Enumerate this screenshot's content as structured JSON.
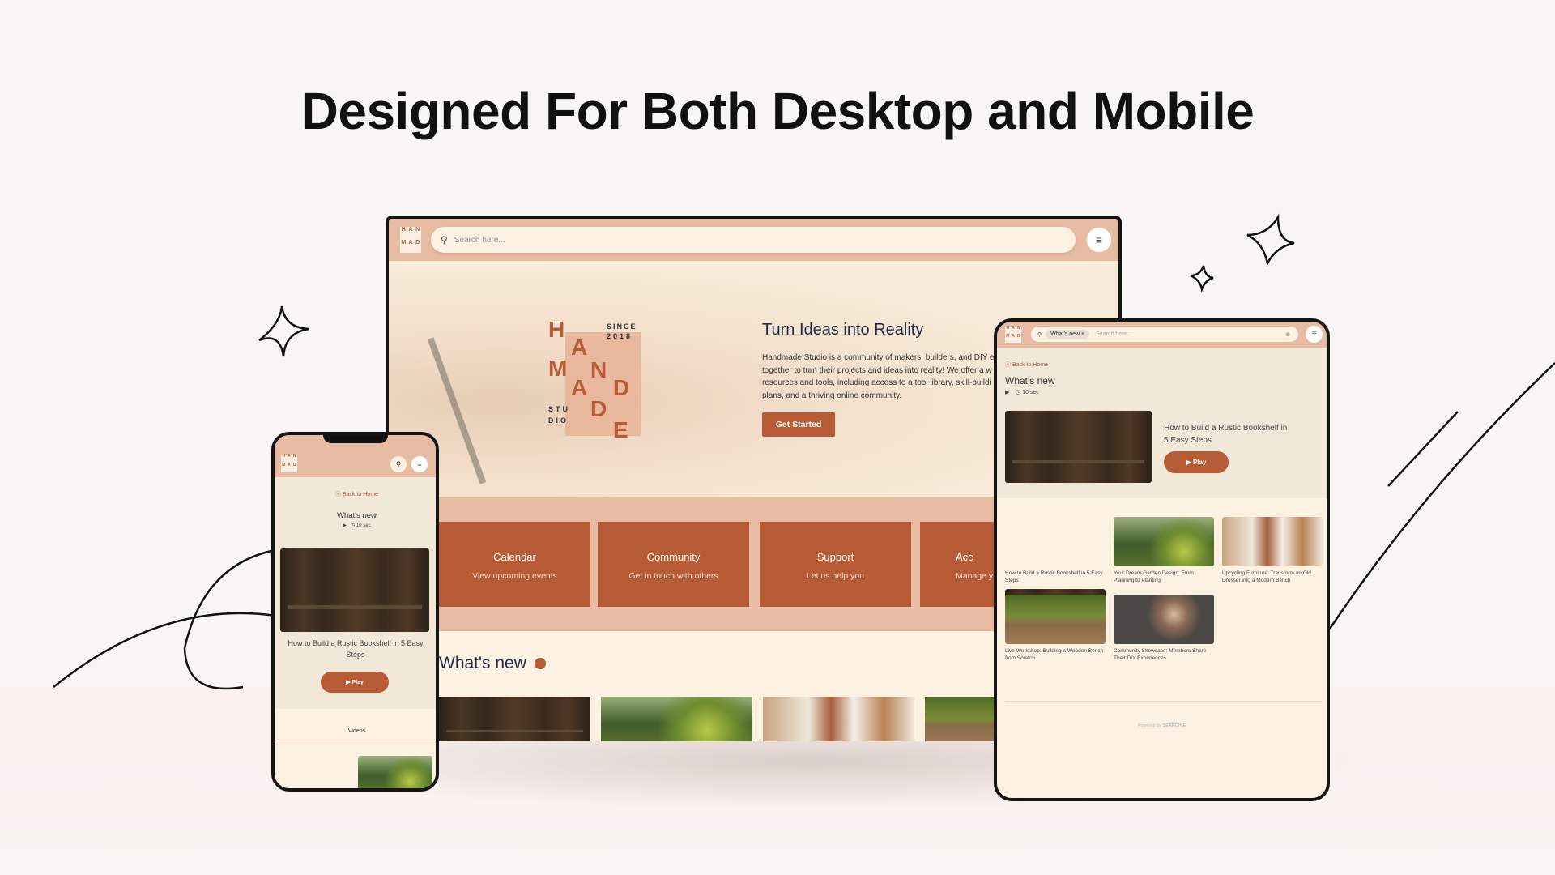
{
  "headline": "Designed For Both Desktop and Mobile",
  "colors": {
    "accent": "#b65b35",
    "header": "#e8bca3",
    "background": "#fdf2e2"
  },
  "logo": {
    "letters": [
      "H",
      "A",
      "N",
      "M",
      "A",
      "D",
      "D",
      "E"
    ],
    "since": "SINCE",
    "year": "2018",
    "studio": "STU",
    "studio2": "DIO"
  },
  "desktop": {
    "search_placeholder": "Search here...",
    "menu_icon": "hamburger-icon",
    "hero": {
      "title": "Turn Ideas into Reality",
      "body": [
        "Handmade Studio is a community of makers, builders, and DIY e",
        "together to turn their projects and ideas into reality! We offer a w",
        "resources and tools, including access to a tool library, skill-buildi",
        "plans, and a thriving online community."
      ],
      "cta": "Get Started"
    },
    "cards": [
      {
        "title": "Calendar",
        "sub": "View upcoming events"
      },
      {
        "title": "Community",
        "sub": "Get in touch with others"
      },
      {
        "title": "Support",
        "sub": "Let us help you"
      },
      {
        "title": "Acc",
        "sub": "Manage y"
      }
    ],
    "section_title": "What's new"
  },
  "tablet": {
    "chip": "What's new",
    "search_placeholder": "Search here...",
    "back": "Back to Home",
    "title": "What's new",
    "duration": "10 sec",
    "featured": {
      "title": "How to Build a Rustic Bookshelf in 5 Easy Steps",
      "play": "Play"
    },
    "videos": [
      {
        "title": "How to Build a Rustic Bookshelf in 5 Easy Steps"
      },
      {
        "title": "Your Dream Garden Design: From Planning to Planting"
      },
      {
        "title": "Upcycling Furniture: Transform an Old Dresser into a Modern Bench"
      },
      {
        "title": "Live Workshop: Building a Wooden Bench from Scratch"
      },
      {
        "title": "Community Showcase: Members Share Their DIY Experiences"
      }
    ],
    "powered_by": "Powered by",
    "brand": "SEARCHIE"
  },
  "phone": {
    "back": "Back to Home",
    "title": "What's new",
    "duration": "10 sec",
    "featured": {
      "title": "How to Build a Rustic Bookshelf in 5 Easy Steps",
      "play": "Play"
    },
    "tab": "Videos"
  }
}
